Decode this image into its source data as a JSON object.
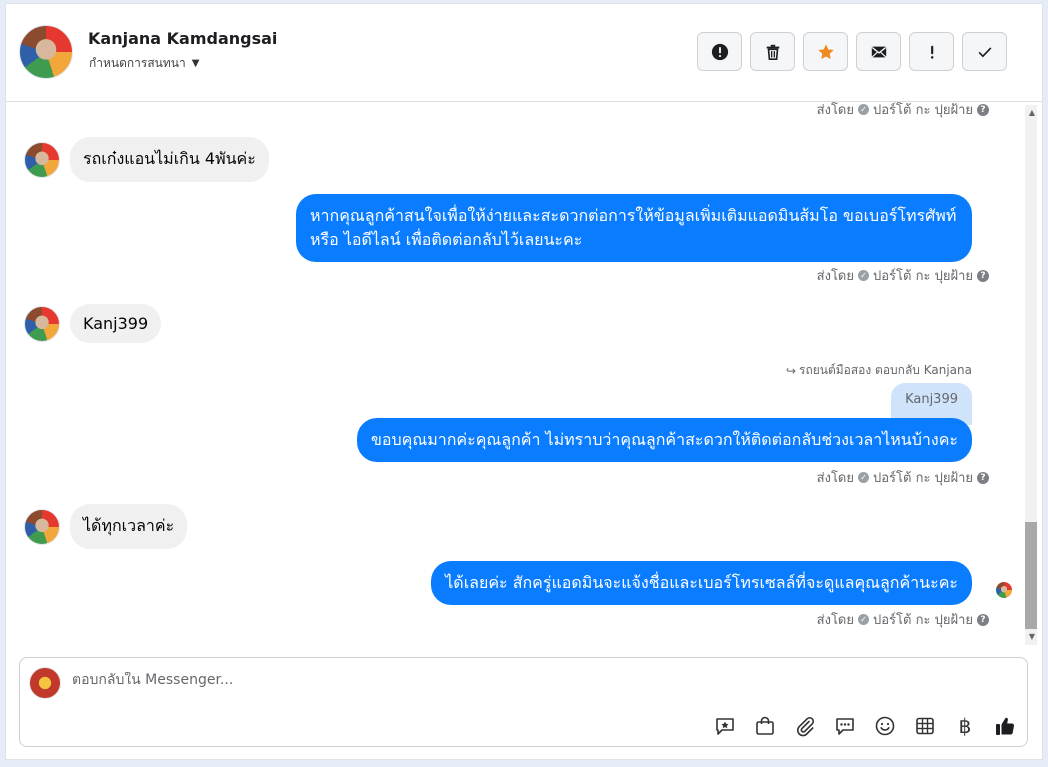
{
  "header": {
    "contact_name": "Kanjana Kamdangsai",
    "assign_label": "กำหนดการสนทนา",
    "actions": [
      {
        "name": "report-button",
        "icon": "alert-circle-icon"
      },
      {
        "name": "delete-button",
        "icon": "trash-icon"
      },
      {
        "name": "star-button",
        "icon": "star-icon"
      },
      {
        "name": "mark-unread-button",
        "icon": "envelope-icon"
      },
      {
        "name": "follow-up-button",
        "icon": "exclamation-icon"
      },
      {
        "name": "mark-done-button",
        "icon": "checkmark-icon"
      }
    ]
  },
  "conversation": {
    "meta_sent_by": "ส่งโดย",
    "meta_sender": "ปอร์โต้ กะ ปุยฝ้าย",
    "msg1_in": "รถเก๋งแอนไม่เกิน 4พันค่ะ",
    "msg2_out": "หากคุณลูกค้าสนใจเพื่อให้ง่ายและสะดวกต่อการให้ข้อมูลเพิ่มเติมแอดมินส้มโอ ขอเบอร์โทรศัพท์ หรือ ไอดีไลน์ เพื่อติดต่อกลับไว้เลยนะคะ",
    "msg3_in": "Kanj399",
    "reply_ref": "รถยนต์มือสอง ตอบกลับ Kanjana",
    "quoted": "Kanj399",
    "msg4_out": "ขอบคุณมากค่ะคุณลูกค้า ไม่ทราบว่าคุณลูกค้าสะดวกให้ติดต่อกลับช่วงเวลาไหนบ้างคะ",
    "msg5_in": "ได้ทุกเวลาค่ะ",
    "msg6_out": "ได้เลยค่ะ สักครู่แอดมินจะแจ้งชื่อและเบอร์โทรเซลล์ที่จะดูแลคุณลูกค้านะคะ"
  },
  "composer": {
    "placeholder": "ตอบกลับใน Messenger...",
    "baht_symbol": "฿"
  },
  "colors": {
    "outgoing_bubble": "#0a7cff",
    "incoming_bubble": "#f0f0f0",
    "star": "#f08a24"
  }
}
